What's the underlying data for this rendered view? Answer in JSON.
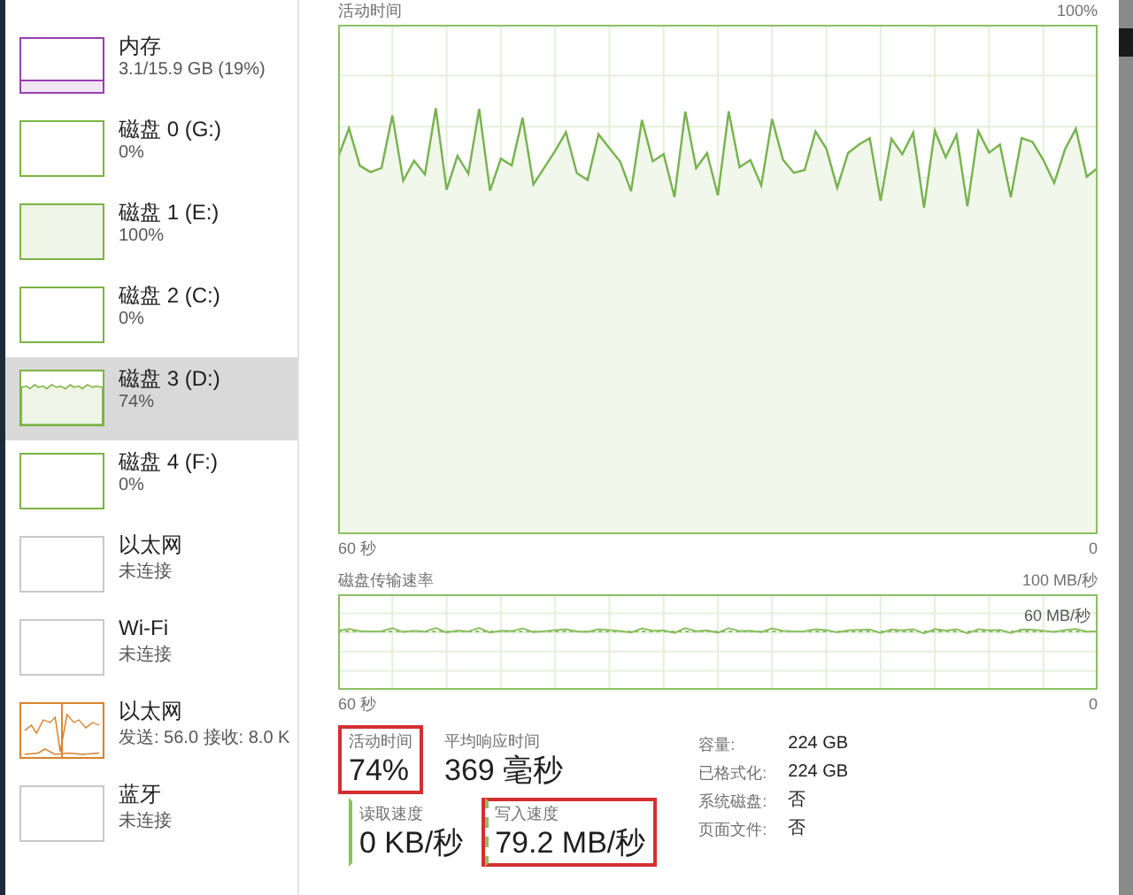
{
  "sidebar": {
    "items": [
      {
        "kind": "memory",
        "title": "内存",
        "subtitle": "3.1/15.9 GB (19%)",
        "color": "#9b3fb0",
        "selected": false
      },
      {
        "kind": "idle",
        "title": "磁盘 0 (G:)",
        "subtitle": "0%",
        "color": "#7cb342",
        "selected": false
      },
      {
        "kind": "full",
        "title": "磁盘 1 (E:)",
        "subtitle": "100%",
        "color": "#7cb342",
        "selected": false
      },
      {
        "kind": "idle",
        "title": "磁盘 2 (C:)",
        "subtitle": "0%",
        "color": "#7cb342",
        "selected": false
      },
      {
        "kind": "busy",
        "title": "磁盘 3 (D:)",
        "subtitle": "74%",
        "color": "#7cb342",
        "selected": true
      },
      {
        "kind": "idle",
        "title": "磁盘 4 (F:)",
        "subtitle": "0%",
        "color": "#7cb342",
        "selected": false
      },
      {
        "kind": "network",
        "title": "以太网",
        "subtitle": "未连接",
        "color": "#c8c8c8",
        "active": false,
        "selected": false
      },
      {
        "kind": "network",
        "title": "Wi-Fi",
        "subtitle": "未连接",
        "color": "#c8c8c8",
        "active": false,
        "selected": false
      },
      {
        "kind": "network",
        "title": "以太网",
        "subtitle": "发送: 56.0 接收: 8.0 K",
        "color": "#d9822b",
        "active": true,
        "selected": false
      },
      {
        "kind": "network",
        "title": "蓝牙",
        "subtitle": "未连接",
        "color": "#c8c8c8",
        "active": false,
        "selected": false
      }
    ]
  },
  "activity_chart": {
    "title": "活动时间",
    "max_label": "100%",
    "time_label": "60 秒",
    "min_label": "0"
  },
  "transfer_chart": {
    "title": "磁盘传输速率",
    "max_label": "100 MB/秒",
    "line_label": "60 MB/秒",
    "time_label": "60 秒",
    "min_label": "0"
  },
  "stats": [
    {
      "label": "活动时间",
      "value": "74%",
      "highlighted": true
    },
    {
      "label": "平均响应时间",
      "value": "369 毫秒",
      "highlighted": false
    }
  ],
  "speeds": [
    {
      "kind": "read",
      "label": "读取速度",
      "value": "0 KB/秒",
      "highlighted": false
    },
    {
      "kind": "write",
      "label": "写入速度",
      "value": "79.2 MB/秒",
      "highlighted": true
    }
  ],
  "properties": [
    {
      "label": "容量:",
      "value": "224 GB"
    },
    {
      "label": "已格式化:",
      "value": "224 GB"
    },
    {
      "label": "系统磁盘:",
      "value": "否"
    },
    {
      "label": "页面文件:",
      "value": "否"
    }
  ]
}
